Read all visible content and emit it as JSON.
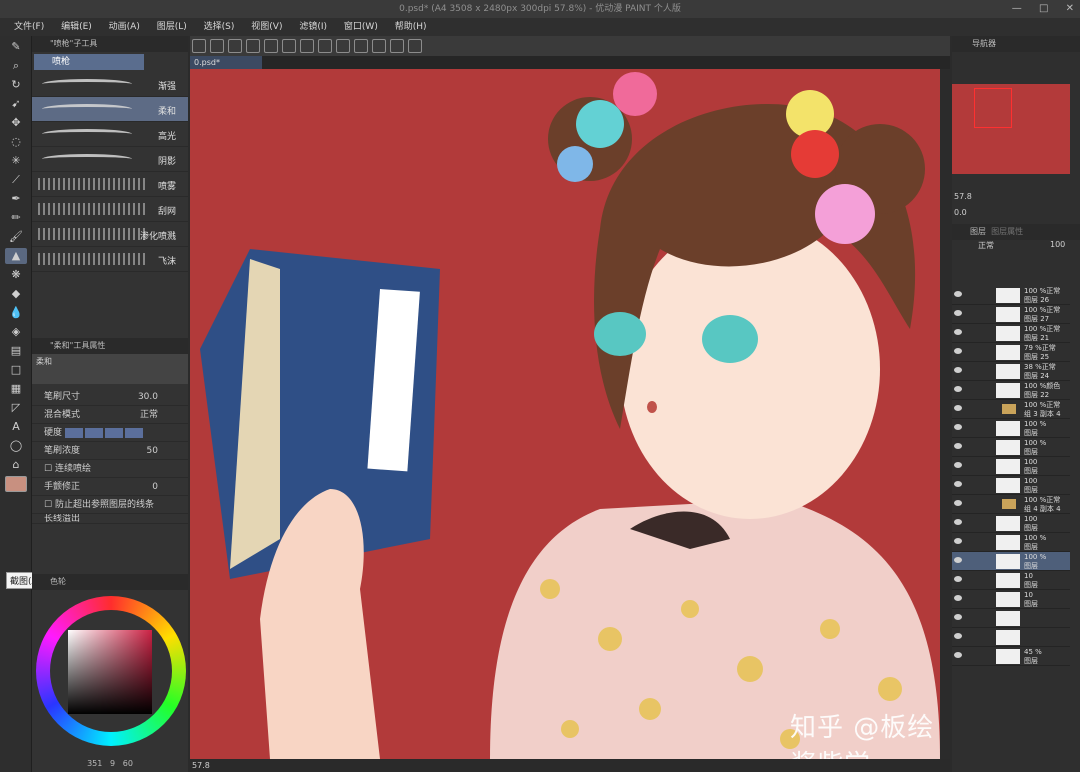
{
  "window": {
    "title": "0.psd* (A4 3508 x 2480px 300dpi 57.8%) - 优动漫 PAINT 个人版",
    "controls": [
      "—",
      "□",
      "✕"
    ]
  },
  "menu": [
    "文件(F)",
    "编辑(E)",
    "动画(A)",
    "图层(L)",
    "选择(S)",
    "视图(V)",
    "滤镜(I)",
    "窗口(W)",
    "帮助(H)"
  ],
  "tools": {
    "tooltip": "截图(Alt + A)"
  },
  "subtool_panel": {
    "header": "\"喷枪\"子工具",
    "group": "喷枪",
    "brushes": [
      {
        "name": "渐强",
        "kind": "stroke",
        "selected": false
      },
      {
        "name": "柔和",
        "kind": "stroke",
        "selected": true
      },
      {
        "name": "高光",
        "kind": "stroke",
        "selected": false
      },
      {
        "name": "阴影",
        "kind": "stroke",
        "selected": false
      },
      {
        "name": "喷雾",
        "kind": "spray",
        "selected": false
      },
      {
        "name": "刮网",
        "kind": "spray",
        "selected": false
      },
      {
        "name": "渗化喷溅",
        "kind": "spray",
        "selected": false
      },
      {
        "name": "飞沫",
        "kind": "spray",
        "selected": false
      }
    ]
  },
  "tool_props": {
    "header": "\"柔和\"工具属性",
    "preview_label": "柔和",
    "brush_size_label": "笔刷尺寸",
    "brush_size_value": "30.0",
    "blend_label": "混合模式",
    "blend_value": "正常",
    "hardness_label": "硬度",
    "density_label": "笔刷浓度",
    "density_value": "50",
    "continuous_label": "连续喷绘",
    "stabilize_label": "手颤修正",
    "stabilize_value": "0",
    "prevent_label": "防止超出参照图层的线条",
    "cutoff_label": "长线溢出"
  },
  "color_panel": {
    "tab": "色轮",
    "footer_a": "351",
    "footer_b": "9",
    "footer_c": "60"
  },
  "document": {
    "tab": "0.psd*",
    "zoom": "57.8"
  },
  "navigator": {
    "tabs": [
      "导航器",
      "",
      ""
    ],
    "zoom": "57.8",
    "rotate": "0.0"
  },
  "layers": {
    "tabs": [
      "图层",
      "图层属性"
    ],
    "blend": "正常",
    "opacity": "100",
    "rows": [
      {
        "pct": "100 %正常",
        "name": "图层 26",
        "kind": "layer"
      },
      {
        "pct": "100 %正常",
        "name": "图层 27",
        "kind": "layer"
      },
      {
        "pct": "100 %正常",
        "name": "图层 21",
        "kind": "layer"
      },
      {
        "pct": "79 %正常",
        "name": "图层 25",
        "kind": "layer"
      },
      {
        "pct": "38 %正常",
        "name": "图层 24",
        "kind": "layer"
      },
      {
        "pct": "100 %颜色",
        "name": "图层 22",
        "kind": "layer"
      },
      {
        "pct": "100 %正常",
        "name": "组 3 副本 4",
        "kind": "folder"
      },
      {
        "pct": "100 %",
        "name": "图层",
        "kind": "layer"
      },
      {
        "pct": "100 %",
        "name": "图层",
        "kind": "layer"
      },
      {
        "pct": "100",
        "name": "图层",
        "kind": "layer"
      },
      {
        "pct": "100",
        "name": "图层",
        "kind": "layer"
      },
      {
        "pct": "100 %正常",
        "name": "组 4 副本 4",
        "kind": "folder"
      },
      {
        "pct": "100",
        "name": "图层",
        "kind": "layer"
      },
      {
        "pct": "100 %",
        "name": "图层",
        "kind": "layer"
      },
      {
        "pct": "100 %",
        "name": "图层",
        "kind": "layer",
        "selected": true
      },
      {
        "pct": "10",
        "name": "图层",
        "kind": "layer"
      },
      {
        "pct": "10",
        "name": "图层",
        "kind": "layer"
      },
      {
        "pct": "",
        "name": "",
        "kind": "layer"
      },
      {
        "pct": "",
        "name": "",
        "kind": "layer"
      },
      {
        "pct": "45 %",
        "name": "图层",
        "kind": "layer"
      }
    ]
  },
  "watermark": "知乎 @板绘酱紫学"
}
